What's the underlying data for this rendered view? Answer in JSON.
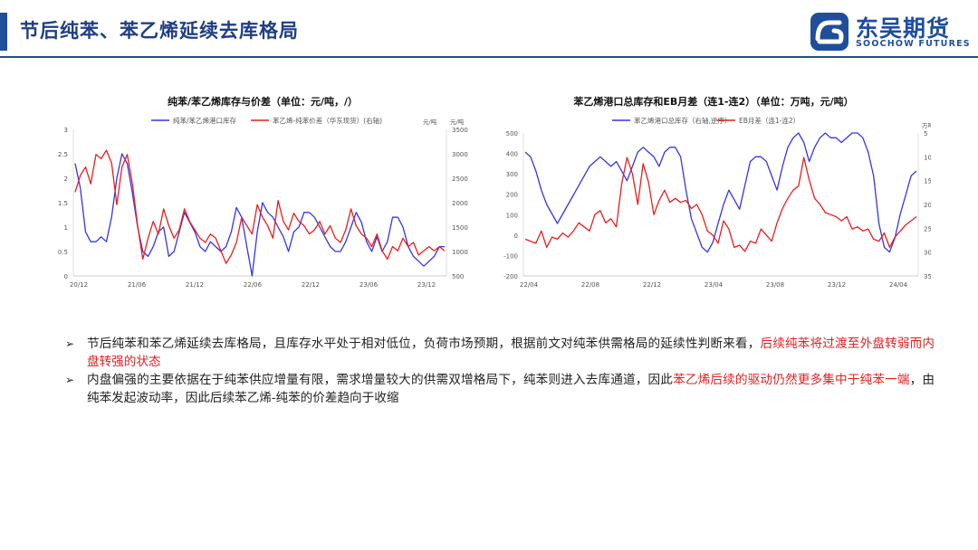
{
  "header": {
    "title": "节后纯苯、苯乙烯延续去库格局"
  },
  "logo": {
    "name_cn": "东吴期货",
    "name_en": "SOOCHOW FUTURES",
    "icon": "soochow-logo-icon",
    "color": "#1f4e9a"
  },
  "chart_data": [
    {
      "type": "line",
      "title": "纯苯/苯乙烯库存与价差（单位：元/吨，/）",
      "legend": [
        "纯苯/苯乙烯港口库存",
        "苯乙烯-纯苯价差（华东现货）(右轴)"
      ],
      "legend_position": "top",
      "colors": [
        "#3535e8",
        "#ee1c1c"
      ],
      "y_left": {
        "unit": "元/吨",
        "ticks": [
          "3",
          "2.5",
          "2",
          "1.5",
          "1",
          "0.5",
          "0"
        ],
        "range": [
          0,
          3
        ]
      },
      "y_right": {
        "unit": "元/吨",
        "ticks": [
          "3500",
          "3000",
          "2500",
          "2000",
          "1500",
          "1000",
          "500"
        ],
        "range": [
          0,
          3500
        ]
      },
      "x_ticks": [
        "20/12",
        "21/06",
        "21/12",
        "22/06",
        "22/12",
        "23/06",
        "23/12"
      ],
      "series": [
        {
          "name": "纯苯/苯乙烯港口库存",
          "axis": "left",
          "values": [
            2.3,
            1.8,
            0.9,
            0.7,
            0.7,
            0.8,
            0.7,
            1.2,
            2.0,
            2.5,
            2.3,
            1.7,
            1.0,
            0.5,
            0.4,
            0.6,
            0.9,
            1.0,
            0.4,
            0.5,
            0.9,
            1.3,
            1.1,
            0.9,
            0.6,
            0.5,
            0.7,
            0.6,
            0.5,
            0.6,
            0.9,
            1.4,
            1.2,
            0.6,
            0.0,
            0.9,
            1.5,
            1.3,
            1.2,
            1.0,
            0.8,
            0.5,
            0.9,
            1.0,
            1.3,
            1.3,
            1.2,
            1.0,
            0.8,
            0.6,
            0.5,
            0.5,
            0.7,
            1.0,
            1.3,
            1.1,
            0.7,
            0.5,
            0.8,
            0.5,
            0.7,
            1.2,
            1.2,
            1.0,
            0.6,
            0.4,
            0.3,
            0.2,
            0.3,
            0.4,
            0.6,
            0.6
          ]
        },
        {
          "name": "苯乙烯-纯苯价差（华东现货）(右轴)",
          "axis": "right",
          "values": [
            2000,
            2400,
            2600,
            2200,
            2900,
            2800,
            3000,
            2700,
            1700,
            2600,
            2900,
            2200,
            1200,
            400,
            900,
            1300,
            1000,
            1600,
            1200,
            900,
            1100,
            1600,
            1300,
            1100,
            900,
            800,
            1000,
            900,
            600,
            300,
            500,
            800,
            1400,
            1200,
            1000,
            1700,
            1400,
            1200,
            900,
            1800,
            1300,
            1100,
            1500,
            1300,
            1200,
            1000,
            1100,
            1300,
            1000,
            1200,
            900,
            800,
            1100,
            1600,
            1200,
            1000,
            900,
            700,
            1000,
            600,
            400,
            700,
            600,
            900,
            700,
            800,
            500,
            600,
            700,
            600,
            700,
            600
          ]
        }
      ]
    },
    {
      "type": "line",
      "title": "苯乙烯港口总库存和EB月差（连1-连2）（单位：万吨，元/吨）",
      "legend": [
        "苯乙烯港口总库存（右轴,逆序）",
        "EB月差（连1-连2）"
      ],
      "legend_position": "top",
      "colors": [
        "#3535e8",
        "#ee1c1c"
      ],
      "y_left": {
        "unit": "元/吨",
        "ticks": [
          "500",
          "400",
          "300",
          "200",
          "100",
          "0",
          "-100",
          "-200"
        ],
        "range": [
          -200,
          500
        ]
      },
      "y_right": {
        "unit": "万吨",
        "ticks": [
          "5",
          "10",
          "15",
          "20",
          "25",
          "30",
          "35"
        ],
        "range": [
          5,
          35
        ],
        "inverted": true
      },
      "x_ticks": [
        "22/04",
        "22/08",
        "22/12",
        "23/04",
        "23/08",
        "23/12",
        "24/04"
      ],
      "series": [
        {
          "name": "苯乙烯港口总库存（右轴,逆序）",
          "axis": "right",
          "values": [
            9,
            10,
            13,
            17,
            20,
            22,
            24,
            22,
            20,
            18,
            16,
            14,
            12,
            11,
            10,
            11,
            12,
            11,
            13,
            15,
            12,
            9,
            8,
            9,
            10,
            12,
            9,
            8,
            8,
            10,
            17,
            23,
            26,
            29,
            30,
            28,
            24,
            20,
            17,
            19,
            21,
            16,
            11,
            10,
            10,
            11,
            14,
            17,
            12,
            8,
            6,
            5,
            7,
            11,
            8,
            6,
            5,
            6,
            6,
            7,
            6,
            5,
            5,
            6,
            9,
            14,
            24,
            29,
            30,
            27,
            22,
            18,
            14,
            13
          ]
        },
        {
          "name": "EB月差（连1-连2）",
          "axis": "left",
          "values": [
            -20,
            -30,
            -40,
            20,
            -60,
            -10,
            -20,
            10,
            -10,
            20,
            60,
            40,
            20,
            100,
            120,
            60,
            80,
            40,
            250,
            380,
            300,
            150,
            350,
            260,
            100,
            170,
            220,
            160,
            180,
            160,
            170,
            130,
            150,
            100,
            20,
            0,
            -40,
            70,
            30,
            -60,
            -50,
            -80,
            -30,
            -40,
            30,
            0,
            -30,
            60,
            130,
            180,
            220,
            240,
            380,
            270,
            180,
            150,
            110,
            100,
            90,
            70,
            90,
            30,
            40,
            20,
            30,
            -20,
            -30,
            10,
            -60,
            -10,
            20,
            50,
            70,
            90
          ]
        }
      ]
    }
  ],
  "bullets": [
    [
      {
        "text": "节后纯苯和苯乙烯延续去库格局，且库存水平处于相对低位，负荷市场预期，根据前文对纯苯供需格局的延续性判断来看，",
        "red": false
      },
      {
        "text": "后续纯苯将过渡至外盘转弱而内盘转强的状态",
        "red": true
      }
    ],
    [
      {
        "text": "内盘偏强的主要依据在于纯苯供应增量有限，需求增量较大的供需双增格局下，纯苯则进入去库通道，因此",
        "red": false
      },
      {
        "text": "苯乙烯后续的驱动仍然更多集中于纯苯一端",
        "red": true
      },
      {
        "text": "，由纯苯发起波动率，因此后续苯乙烯-纯苯的价差趋向于收缩",
        "red": false
      }
    ]
  ]
}
